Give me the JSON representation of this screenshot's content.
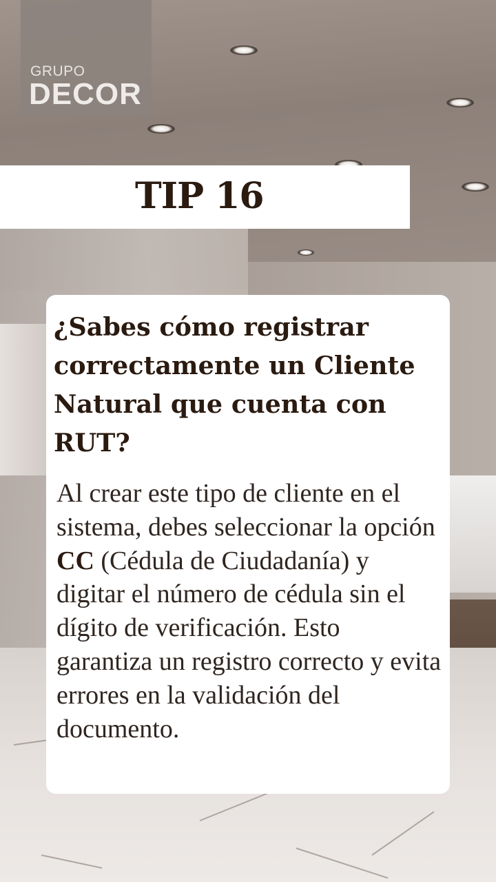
{
  "brand": {
    "line1": "GRUPO",
    "line2": "DECOR"
  },
  "tip": {
    "title": "TIP 16"
  },
  "card": {
    "question": "¿Sabes cómo registrar correctamente un Cliente Natural que cuenta con RUT?",
    "body_part1": "Al crear este tipo de cliente en el sistema, debes seleccionar la opción ",
    "body_bold": "CC",
    "body_part2": " (Cédula de Ciudadanía) y digitar el número de cédula sin el dígito de verificación. Esto garantiza un registro correcto y evita errores en la validación del documento."
  },
  "colors": {
    "text_dark": "#2a1a10",
    "card_bg": "#ffffff",
    "logo_bg": "#8d837e"
  }
}
